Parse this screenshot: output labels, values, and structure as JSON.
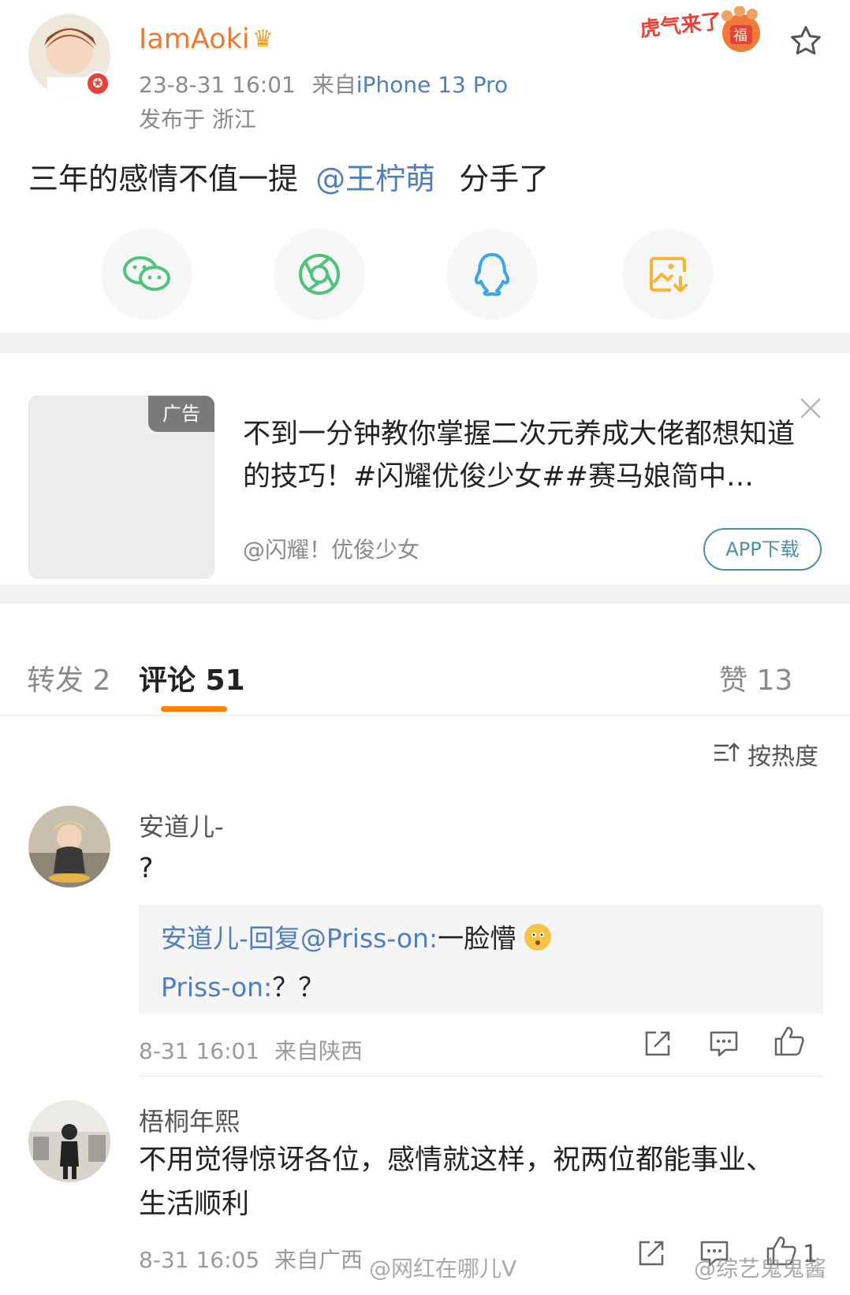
{
  "post": {
    "username": "IamAoki",
    "timestamp": "23-8-31 16:01",
    "source_prefix": "来自",
    "device": "iPhone 13 Pro",
    "location": "发布于 浙江",
    "text_before": "三年的感情不值一提",
    "mention": "@王柠萌",
    "text_after": "分手了",
    "festive_badge": "虎气来了",
    "festive_badge_char": "福",
    "icons": {
      "avatar_badge": "vip-badge-icon",
      "username_badge": "crown-icon",
      "favorite": "star-icon"
    },
    "share_buttons": [
      {
        "name": "wechat",
        "icon": "wechat-icon",
        "color": "#4fc37a"
      },
      {
        "name": "moments",
        "icon": "moments-icon",
        "color": "#4fc37a"
      },
      {
        "name": "qq",
        "icon": "qq-icon",
        "color": "#3aa6e8"
      },
      {
        "name": "save-image",
        "icon": "save-image-icon",
        "color": "#f3b63a"
      }
    ]
  },
  "ad": {
    "tag": "广告",
    "title": "不到一分钟教你掌握二次元养成大佬都想知道的技巧！#闪耀优俊少女##赛马娘简中…",
    "source": "@闪耀！优俊少女",
    "button": "APP下载",
    "close_icon": "close-icon"
  },
  "tabs": {
    "repost": "转发 2",
    "comment": "评论 51",
    "like": "赞 13"
  },
  "sort": {
    "label": "按热度",
    "icon": "sort-icon"
  },
  "comments": [
    {
      "name": "安道儿-",
      "text": "?",
      "replies": [
        {
          "author": "安道儿-回复@Priss-on:",
          "text": "一脸懵",
          "emoji": "confused-emoji-icon"
        },
        {
          "author": "Priss-on:",
          "text": "？？"
        }
      ],
      "time": "8-31 16:01",
      "location": "来自陕西",
      "actions": [
        "share-icon",
        "comment-icon",
        "like-icon"
      ]
    },
    {
      "name": "梧桐年熙",
      "text": "不用觉得惊讶各位，感情就这样，祝两位都能事业、生活顺利",
      "time": "8-31 16:05",
      "location": "来自广西",
      "likes": "1",
      "actions": [
        "share-icon",
        "comment-icon",
        "like-icon"
      ]
    }
  ],
  "watermarks": [
    "@网红在哪儿V",
    "@综艺鬼鬼酱"
  ],
  "colors": {
    "accent_orange": "#ff8200",
    "username_orange": "#eb7a33",
    "link_blue": "#4f7ec0",
    "muted_gray": "#8a8a8a"
  }
}
